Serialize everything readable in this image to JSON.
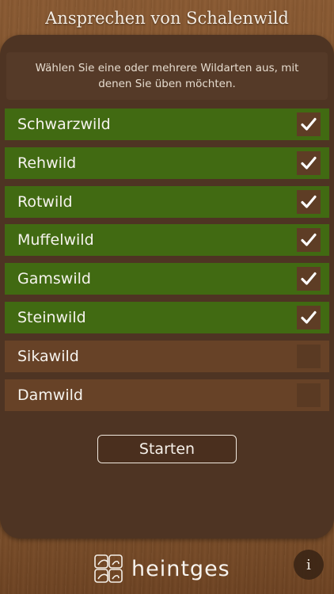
{
  "header": {
    "title": "Ansprechen von Schalenwild"
  },
  "intro": {
    "text": "Wählen Sie eine oder mehrere Wildarten aus, mit denen Sie üben möchten."
  },
  "species": [
    {
      "label": "Schwarzwild",
      "checked": true
    },
    {
      "label": "Rehwild",
      "checked": true
    },
    {
      "label": "Rotwild",
      "checked": true
    },
    {
      "label": "Muffelwild",
      "checked": true
    },
    {
      "label": "Gamswild",
      "checked": true
    },
    {
      "label": "Steinwild",
      "checked": true
    },
    {
      "label": "Sikawild",
      "checked": false
    },
    {
      "label": "Damwild",
      "checked": false
    }
  ],
  "start_button": {
    "label": "Starten"
  },
  "footer": {
    "brand": "heintges",
    "info_label": "i"
  },
  "colors": {
    "selected_row": "#416a12",
    "unselected_row": "#674227",
    "panel": "#4e3423"
  },
  "icons": {
    "checkmark": "checkmark-icon",
    "logo": "heintges-logo-icon",
    "info": "info-icon"
  }
}
